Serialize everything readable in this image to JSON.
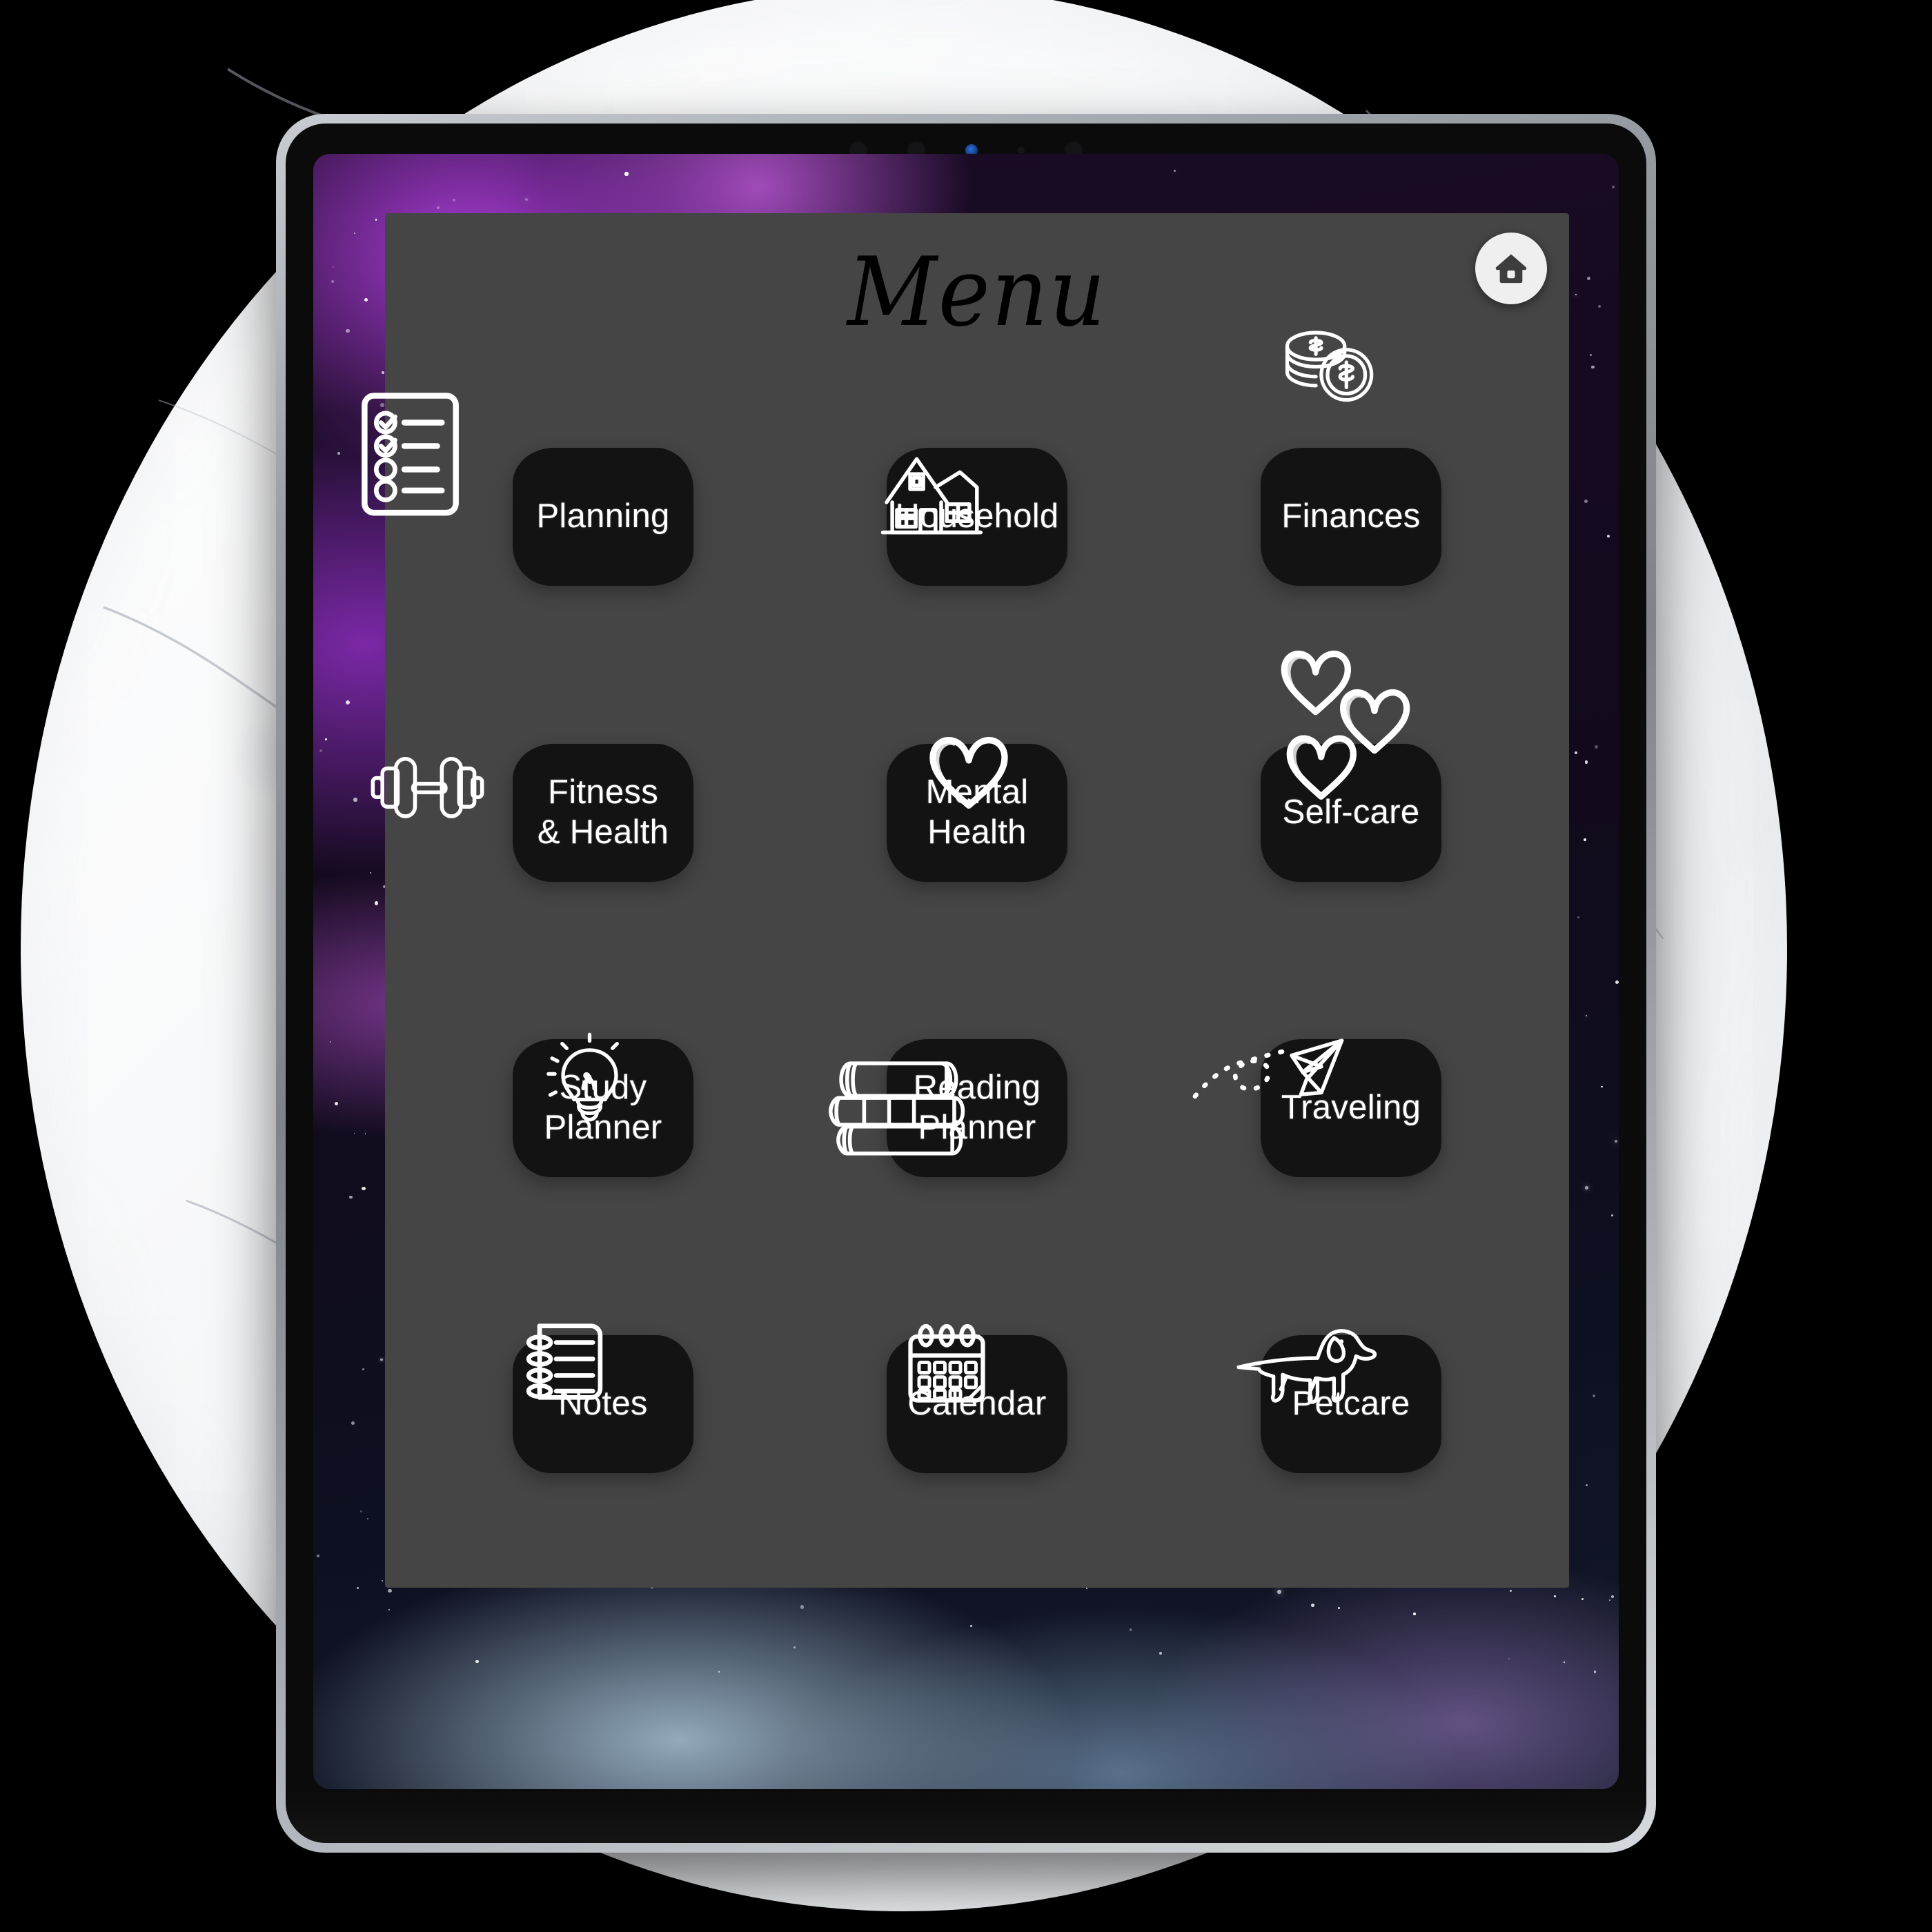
{
  "app": {
    "title": "Menu",
    "home_button_icon": "home-icon",
    "panel_color": "#454545",
    "tile_color": "#131313",
    "text_color": "#ffffff",
    "title_color": "#000000"
  },
  "device": {
    "type": "tablet",
    "frame_color": "#9aa0a6",
    "wallpaper": "purple-blue galaxy nebula",
    "backdrop": "white marble circle on black"
  },
  "menu": {
    "columns": 3,
    "rows": 4,
    "tiles": [
      {
        "label": "Planning",
        "icon": "checklist-icon",
        "icon_position": "left-outside"
      },
      {
        "label": "Household",
        "icon": "house-icon",
        "icon_position": "bottom-center"
      },
      {
        "label": "Finances",
        "icon": "coins-icon",
        "icon_position": "top-right"
      },
      {
        "label": "Fitness\n& Health",
        "icon": "dumbbell-icon",
        "icon_position": "bottom-left"
      },
      {
        "label": "Mental\nHealth",
        "icon": "heart-icon",
        "icon_position": "bottom-right"
      },
      {
        "label": "Self-care",
        "icon": "three-hearts-icon",
        "icon_position": "right"
      },
      {
        "label": "Study\nPlanner",
        "icon": "lightbulb-icon",
        "icon_position": "bottom-right"
      },
      {
        "label": "Reading\nPlanner",
        "icon": "book-stack-icon",
        "icon_position": "bottom-center"
      },
      {
        "label": "Traveling",
        "icon": "paper-plane-icon",
        "icon_position": "bottom-center"
      },
      {
        "label": "Notes",
        "icon": "notepad-icon",
        "icon_position": "bottom-right"
      },
      {
        "label": "Calendar",
        "icon": "calendar-icon",
        "icon_position": "bottom-right"
      },
      {
        "label": "Petcare",
        "icon": "dachshund-icon",
        "icon_position": "bottom-right"
      }
    ]
  }
}
